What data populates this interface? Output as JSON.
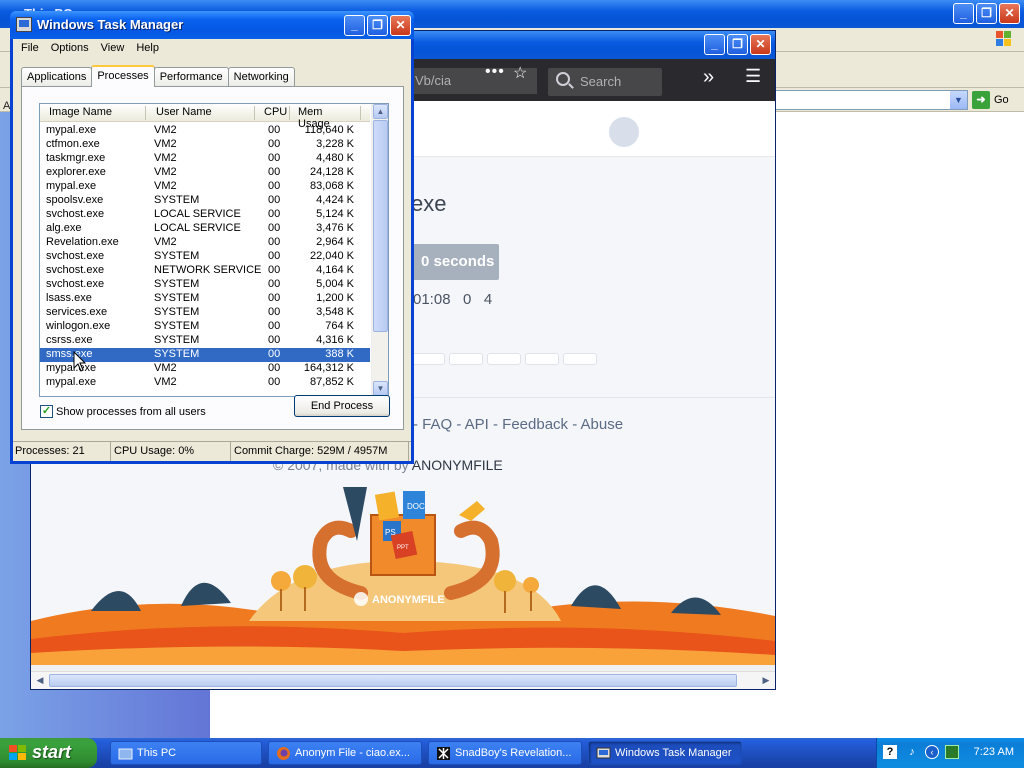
{
  "explorer": {
    "title": "This PC",
    "address_go": "Go",
    "side_letter": "A"
  },
  "firefox": {
    "url_fragment": "Vb/cia",
    "search_placeholder": "Search",
    "page": {
      "file_title_fragment": "exe",
      "download_button_fragment": "0 seconds",
      "stats_fragment": "01:08   0   4",
      "footer_links": "- FAQ - API - Feedback - Abuse",
      "copyright_prefix": "© 2007, made with by",
      "copyright_brand": "ANONYMFILE",
      "logo_text": "ANONYMFILE",
      "logo_badges": [
        "DOC",
        "PS",
        "PPT"
      ]
    }
  },
  "taskmgr": {
    "title": "Windows Task Manager",
    "menu": [
      "File",
      "Options",
      "View",
      "Help"
    ],
    "tabs": [
      "Applications",
      "Processes",
      "Performance",
      "Networking"
    ],
    "active_tab": "Processes",
    "columns": [
      "Image Name",
      "User Name",
      "CPU",
      "Mem Usage"
    ],
    "processes": [
      {
        "name": "mypal.exe",
        "user": "VM2",
        "cpu": "00",
        "mem": "118,640 K"
      },
      {
        "name": "ctfmon.exe",
        "user": "VM2",
        "cpu": "00",
        "mem": "3,228 K"
      },
      {
        "name": "taskmgr.exe",
        "user": "VM2",
        "cpu": "00",
        "mem": "4,480 K"
      },
      {
        "name": "explorer.exe",
        "user": "VM2",
        "cpu": "00",
        "mem": "24,128 K"
      },
      {
        "name": "mypal.exe",
        "user": "VM2",
        "cpu": "00",
        "mem": "83,068 K"
      },
      {
        "name": "spoolsv.exe",
        "user": "SYSTEM",
        "cpu": "00",
        "mem": "4,424 K"
      },
      {
        "name": "svchost.exe",
        "user": "LOCAL SERVICE",
        "cpu": "00",
        "mem": "5,124 K"
      },
      {
        "name": "alg.exe",
        "user": "LOCAL SERVICE",
        "cpu": "00",
        "mem": "3,476 K"
      },
      {
        "name": "Revelation.exe",
        "user": "VM2",
        "cpu": "00",
        "mem": "2,964 K"
      },
      {
        "name": "svchost.exe",
        "user": "SYSTEM",
        "cpu": "00",
        "mem": "22,040 K"
      },
      {
        "name": "svchost.exe",
        "user": "NETWORK SERVICE",
        "cpu": "00",
        "mem": "4,164 K"
      },
      {
        "name": "svchost.exe",
        "user": "SYSTEM",
        "cpu": "00",
        "mem": "5,004 K"
      },
      {
        "name": "lsass.exe",
        "user": "SYSTEM",
        "cpu": "00",
        "mem": "1,200 K"
      },
      {
        "name": "services.exe",
        "user": "SYSTEM",
        "cpu": "00",
        "mem": "3,548 K"
      },
      {
        "name": "winlogon.exe",
        "user": "SYSTEM",
        "cpu": "00",
        "mem": "764 K"
      },
      {
        "name": "csrss.exe",
        "user": "SYSTEM",
        "cpu": "00",
        "mem": "4,316 K"
      },
      {
        "name": "smss.exe",
        "user": "SYSTEM",
        "cpu": "00",
        "mem": "388 K",
        "selected": true
      },
      {
        "name": "mypal.exe",
        "user": "VM2",
        "cpu": "00",
        "mem": "164,312 K"
      },
      {
        "name": "mypal.exe",
        "user": "VM2",
        "cpu": "00",
        "mem": "87,852 K"
      }
    ],
    "show_all_label": "Show processes from all users",
    "show_all_checked": true,
    "end_process_label": "End Process",
    "status": {
      "processes": "Processes: 21",
      "cpu": "CPU Usage: 0%",
      "commit": "Commit Charge: 529M / 4957M"
    }
  },
  "taskbar": {
    "start_label": "start",
    "buttons": [
      {
        "label": "This PC",
        "icon": "folder-icon",
        "active": false
      },
      {
        "label": "Anonym File - ciao.ex...",
        "icon": "firefox-icon",
        "active": false
      },
      {
        "label": "SnadBoy's Revelation...",
        "icon": "revelation-icon",
        "active": false
      },
      {
        "label": "Windows Task Manager",
        "icon": "taskmgr-icon",
        "active": true
      }
    ],
    "clock": "7:23 AM"
  },
  "colors": {
    "xp_blue": "#0a5be0",
    "selection": "#316ac5",
    "start_green": "#3c9b3c",
    "orange_hills": "#f07a1f"
  }
}
